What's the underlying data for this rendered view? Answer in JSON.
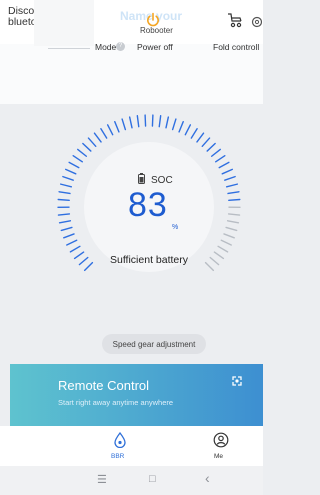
{
  "header": {
    "disconnect_line1": "Disconnect",
    "disconnect_line2": "bluetooth",
    "name_hint": "Name your",
    "device_name": "Robooter"
  },
  "modes": {
    "mode_label": "Mode",
    "power_label": "Power off",
    "fold_label": "Fold controll",
    "help_glyph": "?"
  },
  "battery": {
    "soc_label": "SOC",
    "soc_value": "83",
    "soc_unit": "%",
    "status": "Sufficient battery",
    "level_percent": 83
  },
  "speed": {
    "label": "Speed gear adjustment"
  },
  "remote": {
    "title": "Remote Control",
    "subtitle": "Start right away anytime anywhere"
  },
  "tabs": {
    "bbr": "BBR",
    "me": "Me"
  },
  "navbar": {
    "menu": "☰",
    "home": "□",
    "back": "‹"
  },
  "colors": {
    "accent_blue": "#1e5cd0",
    "power_orange": "#f5a623",
    "gauge_tick_blue": "#2f6fe0",
    "gauge_tick_grey": "#b8bdc4"
  }
}
